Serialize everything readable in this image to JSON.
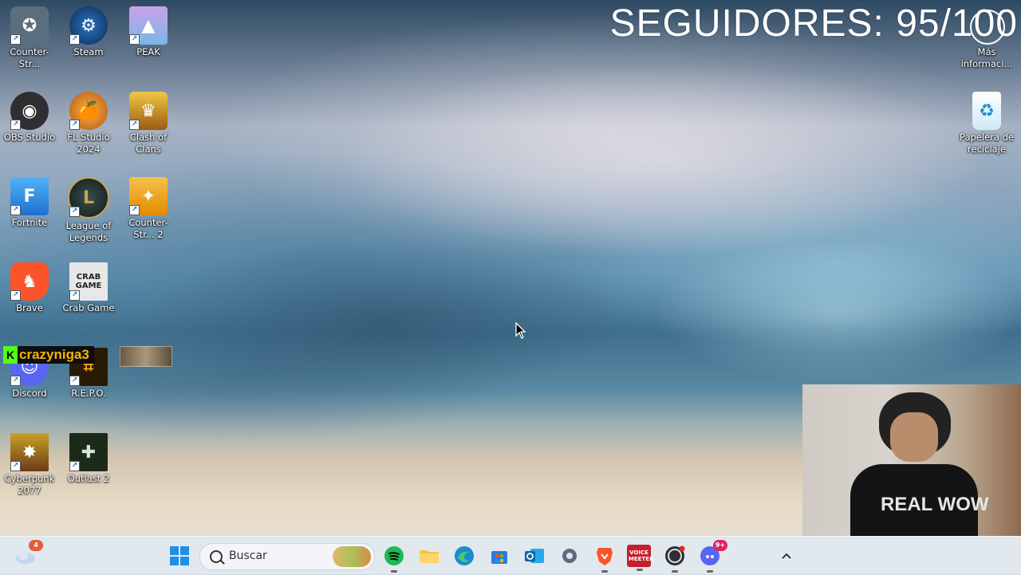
{
  "overlay": {
    "followers": "SEGUIDORES: 95/100",
    "kick_name": "crazyniga3",
    "kick_logo": "K"
  },
  "desktop_icons": [
    {
      "label": "Counter-Str...",
      "icon": "counter-strike-icon",
      "color": "#5a6e7e"
    },
    {
      "label": "Steam",
      "icon": "steam-icon",
      "color": "#1b2838"
    },
    {
      "label": "PEAK",
      "icon": "peak-icon",
      "color": "#7bb6e6"
    },
    {
      "label": "OBS Studio",
      "icon": "obs-icon",
      "color": "#302e31"
    },
    {
      "label": "FL Studio 2024",
      "icon": "fl-studio-icon",
      "color": "#e56a1a"
    },
    {
      "label": "Clash of Clans",
      "icon": "clash-of-clans-icon",
      "color": "#e8b021"
    },
    {
      "label": "Fortnite",
      "icon": "fortnite-icon",
      "color": "#2b8fe8"
    },
    {
      "label": "League of Legends",
      "icon": "league-of-legends-icon",
      "color": "#1e2b2e"
    },
    {
      "label": "Counter-Str... 2",
      "icon": "counter-strike-2-icon",
      "color": "#f2a900"
    },
    {
      "label": "Brave",
      "icon": "brave-icon",
      "color": "#fb542b"
    },
    {
      "label": "Crab Game",
      "icon": "crab-game-icon",
      "color": "#e7e7e7"
    },
    {
      "label": "Discord",
      "icon": "discord-icon",
      "color": "#5865f2"
    },
    {
      "label": "R.E.P.O.",
      "icon": "repo-icon",
      "color": "#2a1a05"
    },
    {
      "label": "Cyberpunk 2077",
      "icon": "cyberpunk-icon",
      "color": "#c9a227"
    },
    {
      "label": "Outlast 2",
      "icon": "outlast-2-icon",
      "color": "#1b2a1b"
    },
    {
      "label": "Más informaci...",
      "icon": "more-info-icon",
      "color": "#ffffff"
    },
    {
      "label": "Papelera de reciclaje",
      "icon": "recycle-bin-icon",
      "color": "#9fd3ea"
    }
  ],
  "icon_glyphs": {
    "steam": "⚙",
    "peak": "▲",
    "obs": "◉",
    "fl": "🍊",
    "coc": "♛",
    "fortnite": "F",
    "lol": "L",
    "cs2": "✦",
    "brave": "♞",
    "crab": "CRAB GAME",
    "discord": "☺",
    "repo": "⌗",
    "cyber": "✸",
    "outlast": "✚",
    "cs": "✪",
    "recycle": "♻"
  },
  "webcam": {
    "shirt_text": "REAL WOW"
  },
  "taskbar": {
    "search_placeholder": "Buscar",
    "weather_badge": "4",
    "discord_badge": "9+",
    "voicemeeter_label": "VOICE MEETER"
  }
}
